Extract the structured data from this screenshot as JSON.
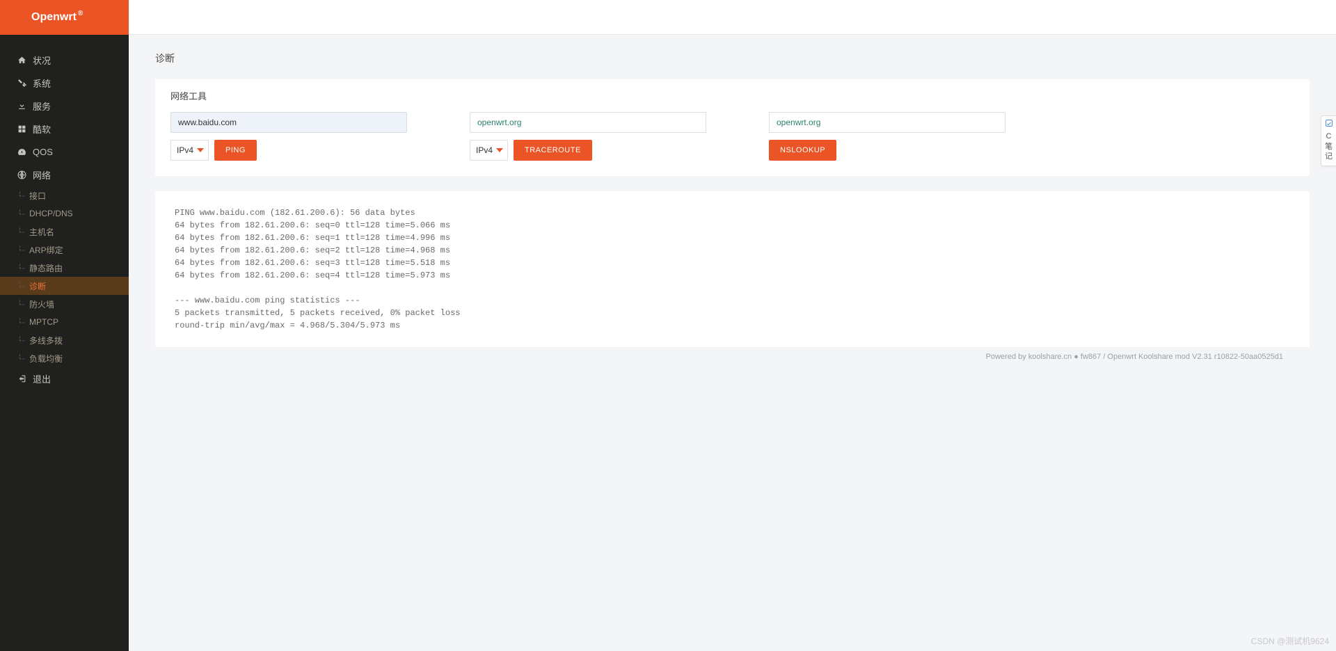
{
  "brand": {
    "name": "Openwrt",
    "reg": "®"
  },
  "sidebar": {
    "items": [
      {
        "label": "状况",
        "icon": "home-icon"
      },
      {
        "label": "系统",
        "icon": "tools-icon"
      },
      {
        "label": "服务",
        "icon": "download-icon"
      },
      {
        "label": "酷软",
        "icon": "grid-icon"
      },
      {
        "label": "QOS",
        "icon": "dashboard-icon"
      },
      {
        "label": "网络",
        "icon": "globe-icon"
      }
    ],
    "sub": [
      {
        "label": "接口"
      },
      {
        "label": "DHCP/DNS"
      },
      {
        "label": "主机名"
      },
      {
        "label": "ARP绑定"
      },
      {
        "label": "静态路由"
      },
      {
        "label": "诊断",
        "active": true
      },
      {
        "label": "防火墙"
      },
      {
        "label": "MPTCP"
      },
      {
        "label": "多线多拨"
      },
      {
        "label": "负载均衡"
      }
    ],
    "logout": {
      "label": "退出",
      "icon": "logout-icon"
    }
  },
  "page": {
    "title": "诊断"
  },
  "tools": {
    "panel_title": "网络工具",
    "ping": {
      "host": "www.baidu.com",
      "ipver": "IPv4",
      "button": "PING"
    },
    "trace": {
      "host": "openwrt.org",
      "ipver": "IPv4",
      "button": "TRACEROUTE"
    },
    "ns": {
      "host": "openwrt.org",
      "button": "NSLOOKUP"
    }
  },
  "output": "PING www.baidu.com (182.61.200.6): 56 data bytes\n64 bytes from 182.61.200.6: seq=0 ttl=128 time=5.066 ms\n64 bytes from 182.61.200.6: seq=1 ttl=128 time=4.996 ms\n64 bytes from 182.61.200.6: seq=2 ttl=128 time=4.968 ms\n64 bytes from 182.61.200.6: seq=3 ttl=128 time=5.518 ms\n64 bytes from 182.61.200.6: seq=4 ttl=128 time=5.973 ms\n\n--- www.baidu.com ping statistics ---\n5 packets transmitted, 5 packets received, 0% packet loss\nround-trip min/avg/max = 4.968/5.304/5.973 ms",
  "footer": "Powered by koolshare.cn ● fw867 / Openwrt Koolshare mod V2.31 r10822-50aa0525d1",
  "side_widget": {
    "line1": "C",
    "line2": "笔",
    "line3": "记"
  },
  "watermark": "CSDN @测试机9624"
}
